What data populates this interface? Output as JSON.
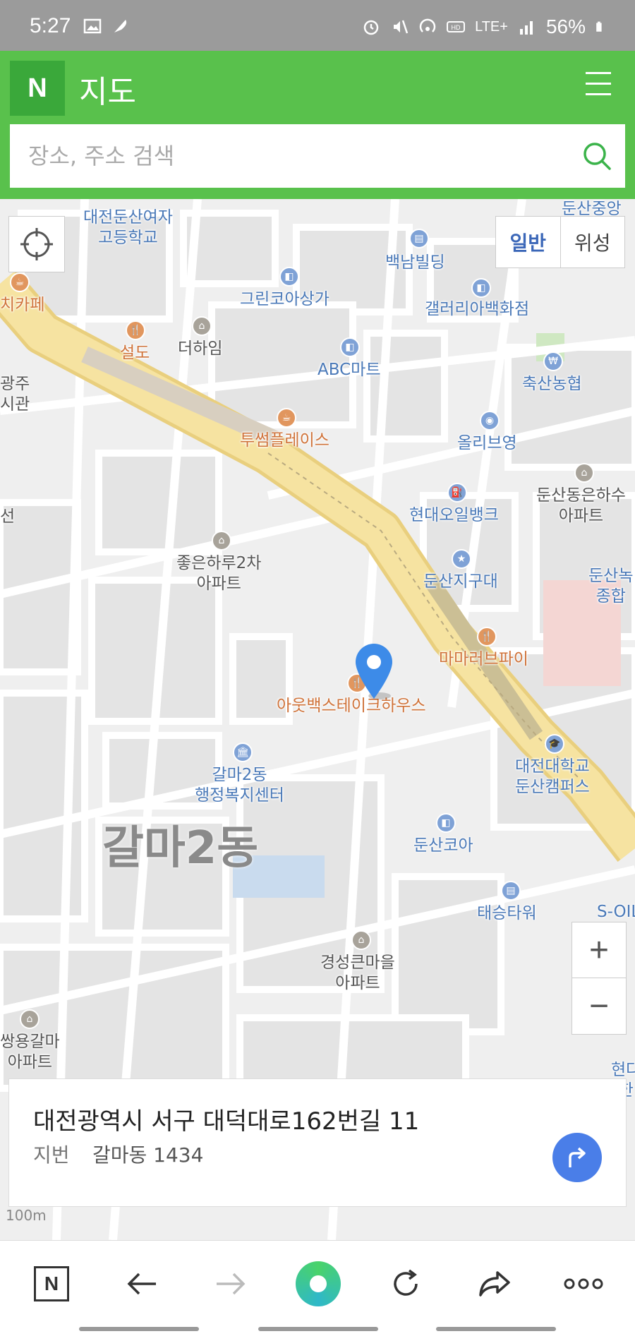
{
  "status_bar": {
    "time": "5:27",
    "battery": "56%",
    "network": "LTE+",
    "icons": [
      "image-icon",
      "feather-icon",
      "alarm-icon",
      "mute-icon",
      "hotspot-icon",
      "hd-icon",
      "signal-icon",
      "battery-icon"
    ]
  },
  "header": {
    "logo": "N",
    "title": "지도",
    "menu_icon": "hamburger-icon"
  },
  "search": {
    "placeholder": "장소, 주소 검색",
    "value": ""
  },
  "map": {
    "map_type": {
      "normal": "일반",
      "satellite": "위성",
      "selected": "일반"
    },
    "district": "갈마2동",
    "zoom_in": "+",
    "zoom_out": "−",
    "scale": "100m",
    "pois": {
      "p1": "대전둔산여자\n고등학교",
      "p2": "백남빌딩",
      "p3": "둔산중앙",
      "p4": "치카페",
      "p5": "그린코아상가",
      "p6": "갤러리아백화점",
      "p7": "설도",
      "p8": "더하임",
      "p9": "ABC마트",
      "p10": "축산농협",
      "p11": "광주\n시관",
      "p12": "투썸플레이스",
      "p13": "올리브영",
      "p14": "둔산동은하수\n아파트",
      "p15": "현대오일뱅크",
      "p16": "선",
      "p17": "좋은하루2차\n아파트",
      "p18": "둔산지구대",
      "p19": "둔산녹\n종합",
      "p20": "마마러브파이",
      "p21": "아웃백스테이크하우스",
      "p22": "대전대학교\n둔산캠퍼스",
      "p23": "갈마2동\n행정복지센터",
      "p24": "둔산코아",
      "p25": "태승타워",
      "p26": "S-OIL",
      "p27": "경성큰마을\n아파트",
      "p28": "쌍용갈마\n아파트",
      "p29": "현다\n한"
    }
  },
  "address_card": {
    "road_address": "대전광역시 서구 대덕대로162번길 11",
    "jibun_label": "지번",
    "jibun_value": "갈마동 1434"
  },
  "colors": {
    "brand_green": "#59c14c",
    "road_yellow": "#f6e3a1",
    "accent_blue": "#4a7ee8",
    "pin_blue": "#3d8be8"
  }
}
